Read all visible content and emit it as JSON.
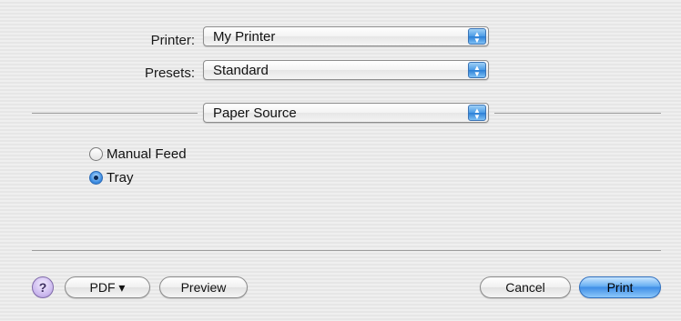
{
  "printer": {
    "label": "Printer:",
    "value": "My Printer"
  },
  "presets": {
    "label": "Presets:",
    "value": "Standard"
  },
  "pane": {
    "value": "Paper Source"
  },
  "source_options": [
    {
      "label": "Manual Feed",
      "selected": false
    },
    {
      "label": "Tray",
      "selected": true
    }
  ],
  "buttons": {
    "help": "?",
    "pdf": "PDF ▾",
    "preview": "Preview",
    "cancel": "Cancel",
    "print": "Print"
  },
  "colors": {
    "accent": "#3f8ee6",
    "help_purple": "#cbb8ee"
  }
}
